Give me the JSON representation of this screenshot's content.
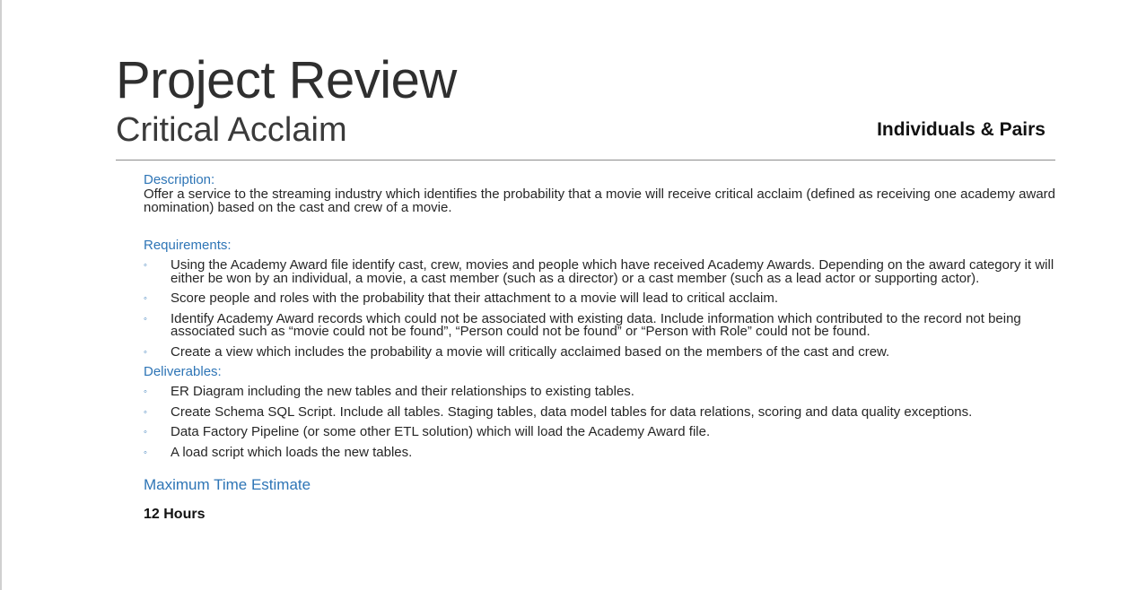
{
  "header": {
    "title": "Project Review",
    "subtitle": "Critical Acclaim",
    "audience": "Individuals & Pairs"
  },
  "description": {
    "heading": "Description:",
    "text": "Offer a service to the streaming industry which identifies the probability that a movie will receive critical acclaim (defined as receiving one academy award nomination) based on the cast and crew of a movie."
  },
  "requirements": {
    "heading": "Requirements:",
    "bullet": "◦",
    "items": [
      "Using the Academy Award file identify cast, crew, movies and people which have received Academy Awards. Depending on the award category it will either be won by an individual, a movie, a cast member (such as a director) or a cast member (such as a lead actor or supporting actor).",
      "Score people and roles with the probability that their attachment to a movie will lead to critical acclaim.",
      "Identify Academy Award records which could not be associated with existing data. Include information which contributed to the record not being associated such as “movie could not be found”, “Person could not be found” or “Person with Role” could not be found.",
      "Create a view which includes the probability a movie will critically acclaimed based on the members of the cast and crew."
    ]
  },
  "deliverables": {
    "heading": "Deliverables:",
    "items": [
      "ER Diagram including the new tables and their relationships to existing tables.",
      "Create Schema SQL Script. Include all tables. Staging tables, data model tables for data relations, scoring and data quality exceptions.",
      "Data Factory Pipeline (or some other ETL solution) which will load the Academy Award file.",
      "A load script which loads the new tables."
    ]
  },
  "estimate": {
    "heading": "Maximum Time Estimate",
    "value": "12 Hours"
  },
  "colors": {
    "accent": "#2e75b6",
    "text": "#262626",
    "rule": "#8c8c8c"
  }
}
